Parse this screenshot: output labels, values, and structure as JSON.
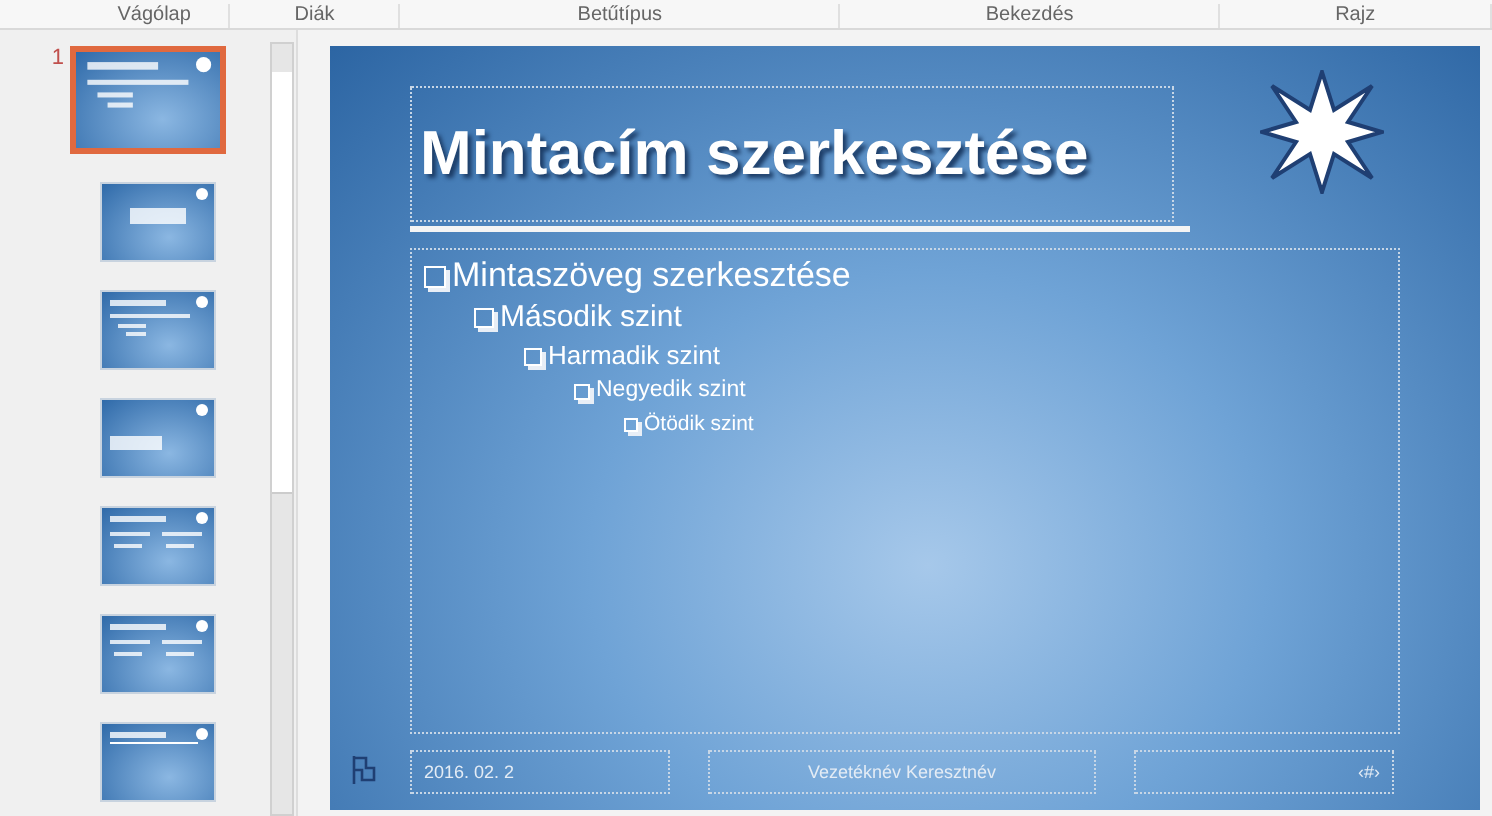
{
  "ribbon_groups": [
    "Vágólap",
    "Diák",
    "Betűtípus",
    "Bekezdés",
    "Rajz"
  ],
  "thumbnails": [
    {
      "number": "1",
      "selected": true,
      "kind": "content"
    },
    {
      "selected": false,
      "kind": "title"
    },
    {
      "selected": false,
      "kind": "content"
    },
    {
      "selected": false,
      "kind": "section"
    },
    {
      "selected": false,
      "kind": "two-content"
    },
    {
      "selected": false,
      "kind": "two-content"
    },
    {
      "selected": false,
      "kind": "title-only"
    }
  ],
  "slide": {
    "title": "Mintacím szerkesztése",
    "body": [
      {
        "text": "Mintaszöveg szerkesztése",
        "children": [
          {
            "text": "Második szint",
            "children": [
              {
                "text": "Harmadik szint",
                "children": [
                  {
                    "text": "Negyedik szint",
                    "children": [
                      {
                        "text": "Ötödik szint"
                      }
                    ]
                  }
                ]
              }
            ]
          }
        ]
      }
    ],
    "footer": {
      "date": "2016. 02. 2",
      "name": "Vezetéknév Keresztnév",
      "page": "‹#›"
    }
  }
}
